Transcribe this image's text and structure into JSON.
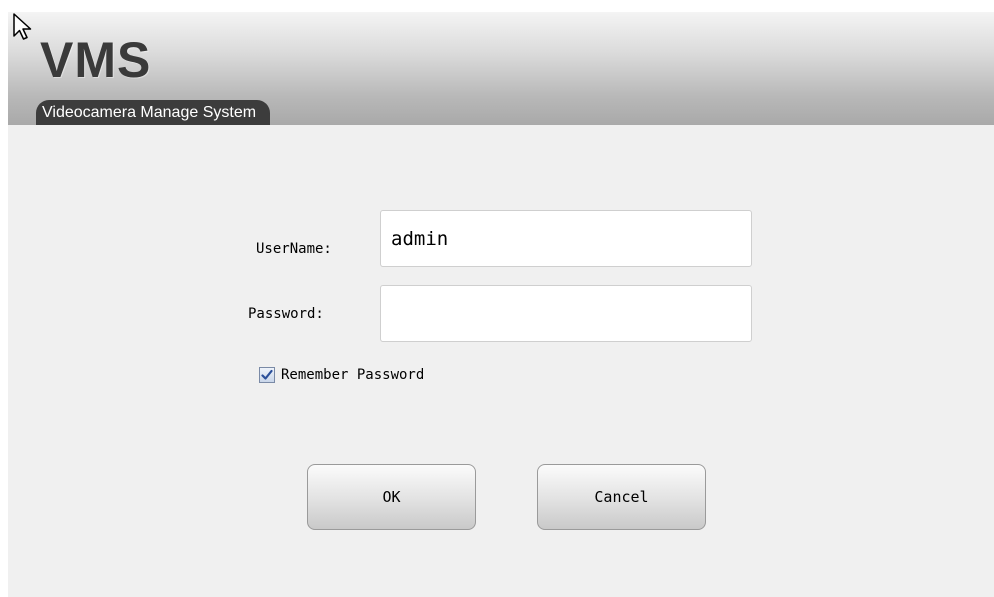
{
  "header": {
    "logo": "VMS",
    "subtitle": "Videocamera Manage System"
  },
  "form": {
    "username_label": "UserName:",
    "username_value": "admin",
    "password_label": "Password:",
    "password_value": "",
    "remember_label": "Remember Password",
    "remember_checked": true
  },
  "buttons": {
    "ok_label": "OK",
    "cancel_label": "Cancel"
  },
  "icons": {
    "cursor": "mouse-pointer-icon",
    "check": "checkmark-icon"
  },
  "colors": {
    "header_dark": "#a9a9a9",
    "pill": "#3c3c3c",
    "checkbox_check": "#2a4f9a"
  }
}
